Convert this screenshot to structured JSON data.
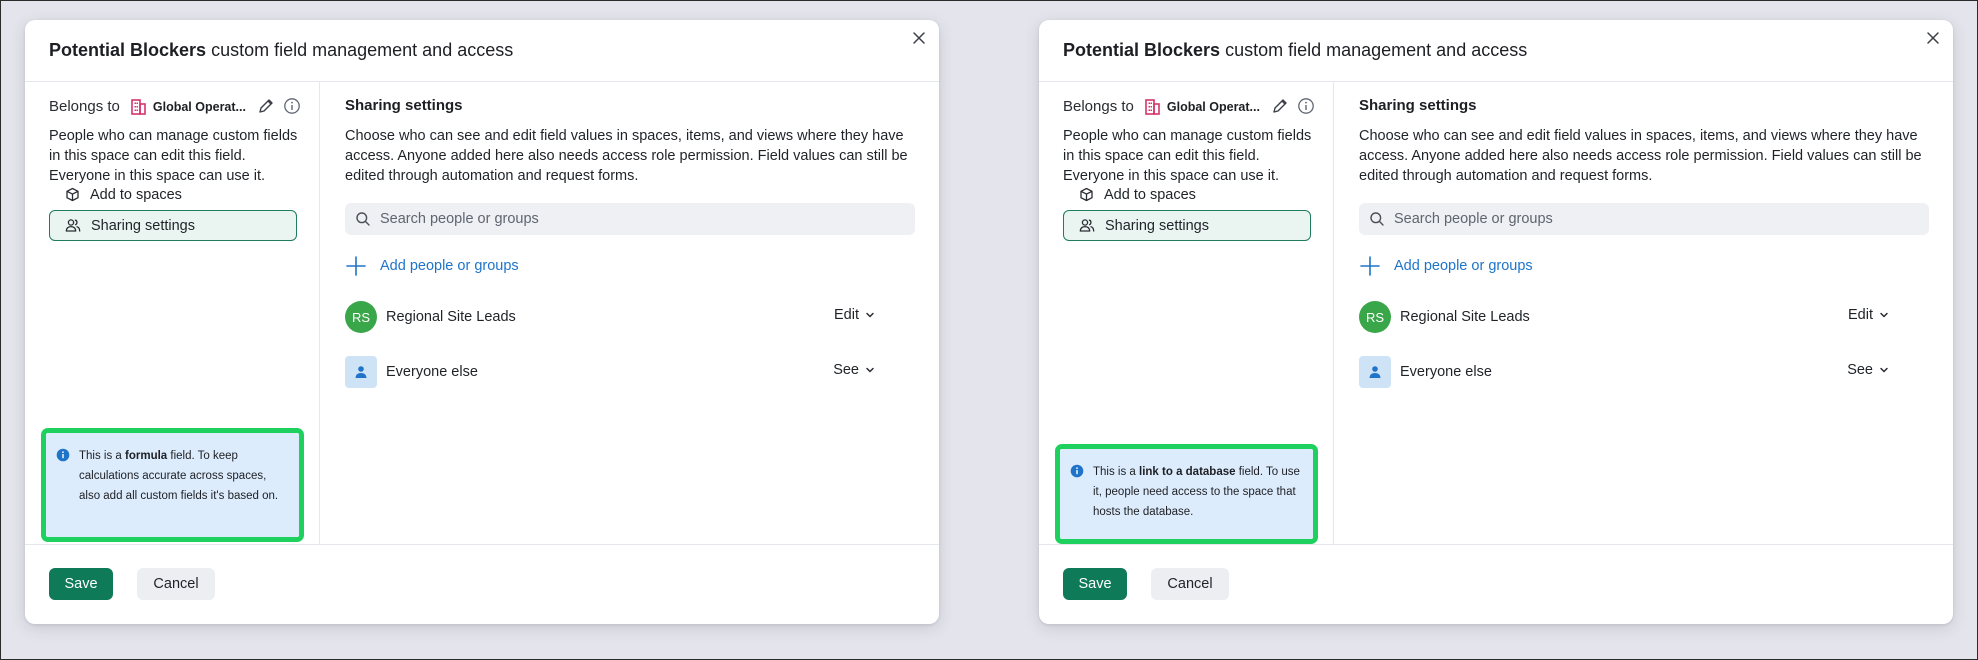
{
  "colors": {
    "accent_green": "#0f7a57",
    "link_blue": "#1f74c9",
    "highlight_green": "#1ed15e",
    "callout_bg": "#dcecfc",
    "space_icon": "#d6336c"
  },
  "dialogs": [
    {
      "title_bold": "Potential Blockers",
      "title_rest": " custom field management and access",
      "belongs_label": "Belongs to",
      "space_name": "Global Operat...",
      "left_description": "People who can manage custom fields in this space can edit this field. Everyone in this space can use it.",
      "nav": {
        "add_to_spaces": "Add to spaces",
        "sharing_settings": "Sharing settings"
      },
      "callout": {
        "pre": "This is a ",
        "bold": "formula",
        "post": " field. To keep calculations accurate across spaces, also add all custom fields it's based on."
      },
      "section_title": "Sharing settings",
      "section_description": "Choose who can see and edit field values in spaces, items, and views where they have access. Anyone added here also needs access role permission. Field values can still be edited through automation and request forms.",
      "search_placeholder": "Search people or groups",
      "add_people_label": "Add people or groups",
      "people": [
        {
          "initials": "RS",
          "name": "Regional Site Leads",
          "permission": "Edit"
        },
        {
          "initials": "",
          "name": "Everyone else",
          "permission": "See"
        }
      ],
      "footer": {
        "save": "Save",
        "cancel": "Cancel"
      }
    },
    {
      "title_bold": "Potential Blockers",
      "title_rest": " custom field management and access",
      "belongs_label": "Belongs to",
      "space_name": "Global Operat...",
      "left_description": "People who can manage custom fields in this space can edit this field. Everyone in this space can use it.",
      "nav": {
        "add_to_spaces": "Add to spaces",
        "sharing_settings": "Sharing settings"
      },
      "callout": {
        "pre": "This is a ",
        "bold": "link to a database",
        "post": " field. To use it, people need access to the space that hosts the database."
      },
      "section_title": "Sharing settings",
      "section_description": "Choose who can see and edit field values in spaces, items, and views where they have access. Anyone added here also needs access role permission. Field values can still be edited through automation and request forms.",
      "search_placeholder": "Search people or groups",
      "add_people_label": "Add people or groups",
      "people": [
        {
          "initials": "RS",
          "name": "Regional Site Leads",
          "permission": "Edit"
        },
        {
          "initials": "",
          "name": "Everyone else",
          "permission": "See"
        }
      ],
      "footer": {
        "save": "Save",
        "cancel": "Cancel"
      }
    }
  ]
}
